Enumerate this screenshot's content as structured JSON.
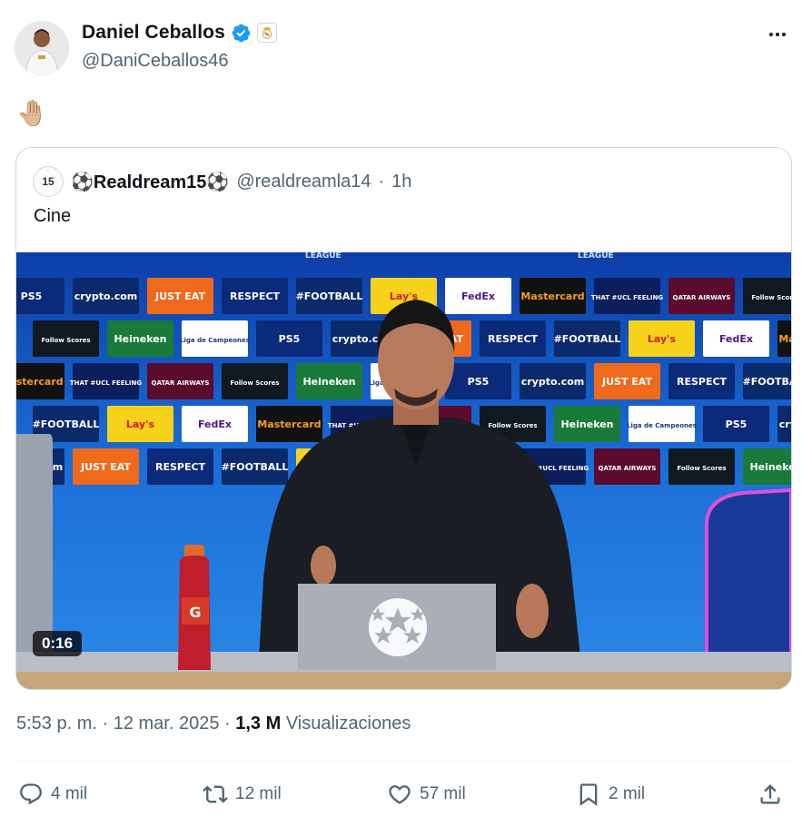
{
  "author": {
    "display_name": "Daniel Ceballos",
    "handle": "@DaniCeballos46",
    "verified_icon": "verified-badge-icon",
    "affiliate_icon": "real-madrid-crest-icon"
  },
  "tweet": {
    "text": "🤚🏼"
  },
  "quote": {
    "avatar_text": "15",
    "display_name": "⚽Realdream15⚽",
    "handle": "@realdreamla14",
    "separator": "·",
    "time": "1h",
    "text": "Cine",
    "video": {
      "duration": "0:16",
      "banner_text": "LEAGUE",
      "sponsor_labels": [
        "PS5",
        "QATAR AIRWAYS",
        "Lay's",
        "crypto.com",
        "Follow Scores",
        "FedEx",
        "JUST EAT",
        "Heineken",
        "Mastercard",
        "RESPECT",
        "Liga de Campeones",
        "THAT #UCL FEELING",
        "#FOOTBALL"
      ]
    }
  },
  "meta": {
    "timestamp": "5:53 p. m. · 12 mar. 2025 · ",
    "views_count": "1,3 M",
    "views_label": " Visualizaciones"
  },
  "actions": {
    "reply": {
      "icon": "reply-icon",
      "count": "4 mil"
    },
    "repost": {
      "icon": "repost-icon",
      "count": "12 mil"
    },
    "like": {
      "icon": "heart-icon",
      "count": "57 mil"
    },
    "bookmark": {
      "icon": "bookmark-icon",
      "count": "2 mil"
    },
    "share": {
      "icon": "share-icon"
    }
  },
  "colors": {
    "text_primary": "#0f1419",
    "text_secondary": "#536471",
    "verified_blue": "#1d9bf0",
    "border": "#cfd9de",
    "video_backdrop": "#1d6fd6"
  }
}
